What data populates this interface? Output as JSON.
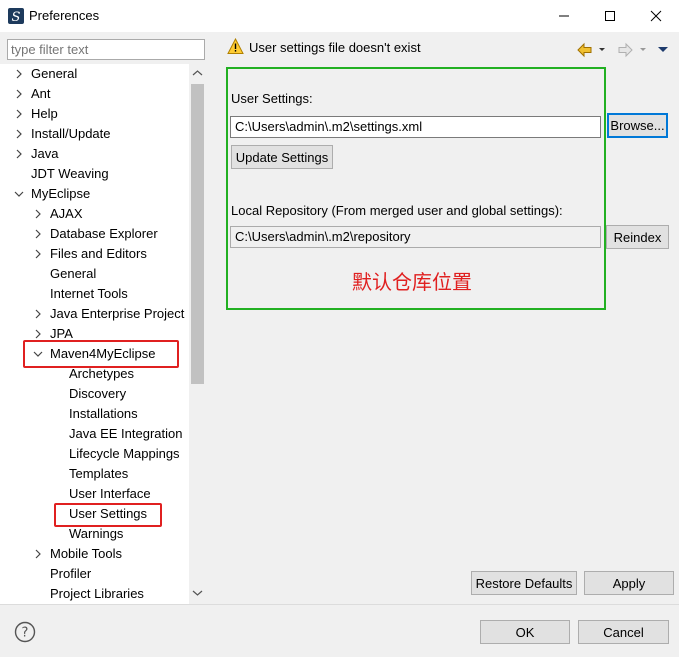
{
  "window": {
    "title": "Preferences",
    "minimize_glyph": "—",
    "maximize_glyph": "☐",
    "close_glyph": "✕"
  },
  "filter": {
    "placeholder": "type filter text"
  },
  "tree": {
    "items": [
      {
        "label": "General",
        "chevron": "›"
      },
      {
        "label": "Ant",
        "chevron": "›"
      },
      {
        "label": "Help",
        "chevron": "›"
      },
      {
        "label": "Install/Update",
        "chevron": "›"
      },
      {
        "label": "Java",
        "chevron": "›"
      },
      {
        "label": "JDT Weaving",
        "chevron": ""
      },
      {
        "label": "MyEclipse",
        "chevron": "⌄"
      },
      {
        "label": "AJAX",
        "chevron": "›"
      },
      {
        "label": "Database Explorer",
        "chevron": "›"
      },
      {
        "label": "Files and Editors",
        "chevron": "›"
      },
      {
        "label": "General",
        "chevron": ""
      },
      {
        "label": "Internet Tools",
        "chevron": ""
      },
      {
        "label": "Java Enterprise Project",
        "chevron": "›"
      },
      {
        "label": "JPA",
        "chevron": "›"
      },
      {
        "label": "Maven4MyEclipse",
        "chevron": "⌄"
      },
      {
        "label": "Archetypes",
        "chevron": ""
      },
      {
        "label": "Discovery",
        "chevron": ""
      },
      {
        "label": "Installations",
        "chevron": ""
      },
      {
        "label": "Java EE Integration",
        "chevron": ""
      },
      {
        "label": "Lifecycle Mappings",
        "chevron": ""
      },
      {
        "label": "Templates",
        "chevron": ""
      },
      {
        "label": "User Interface",
        "chevron": ""
      },
      {
        "label": "User Settings",
        "chevron": ""
      },
      {
        "label": "Warnings",
        "chevron": ""
      },
      {
        "label": "Mobile Tools",
        "chevron": "›"
      },
      {
        "label": "Profiler",
        "chevron": ""
      },
      {
        "label": "Project Libraries",
        "chevron": ""
      }
    ]
  },
  "page": {
    "message": "User settings file doesn't exist",
    "user_settings_label": "User Settings:",
    "user_settings_value": "C:\\Users\\admin\\.m2\\settings.xml",
    "browse_label": "Browse...",
    "update_label": "Update Settings",
    "local_repo_label": "Local Repository (From merged user and global settings):",
    "local_repo_value": "C:\\Users\\admin\\.m2\\repository",
    "reindex_label": "Reindex",
    "annotation": "默认仓库位置",
    "restore_label": "Restore Defaults",
    "apply_label": "Apply"
  },
  "footer": {
    "ok_label": "OK",
    "cancel_label": "Cancel",
    "help_glyph": "?"
  },
  "colors": {
    "highlight_red": "#e02020",
    "annotation_green": "#22b022",
    "focus_blue": "#0078d7"
  }
}
